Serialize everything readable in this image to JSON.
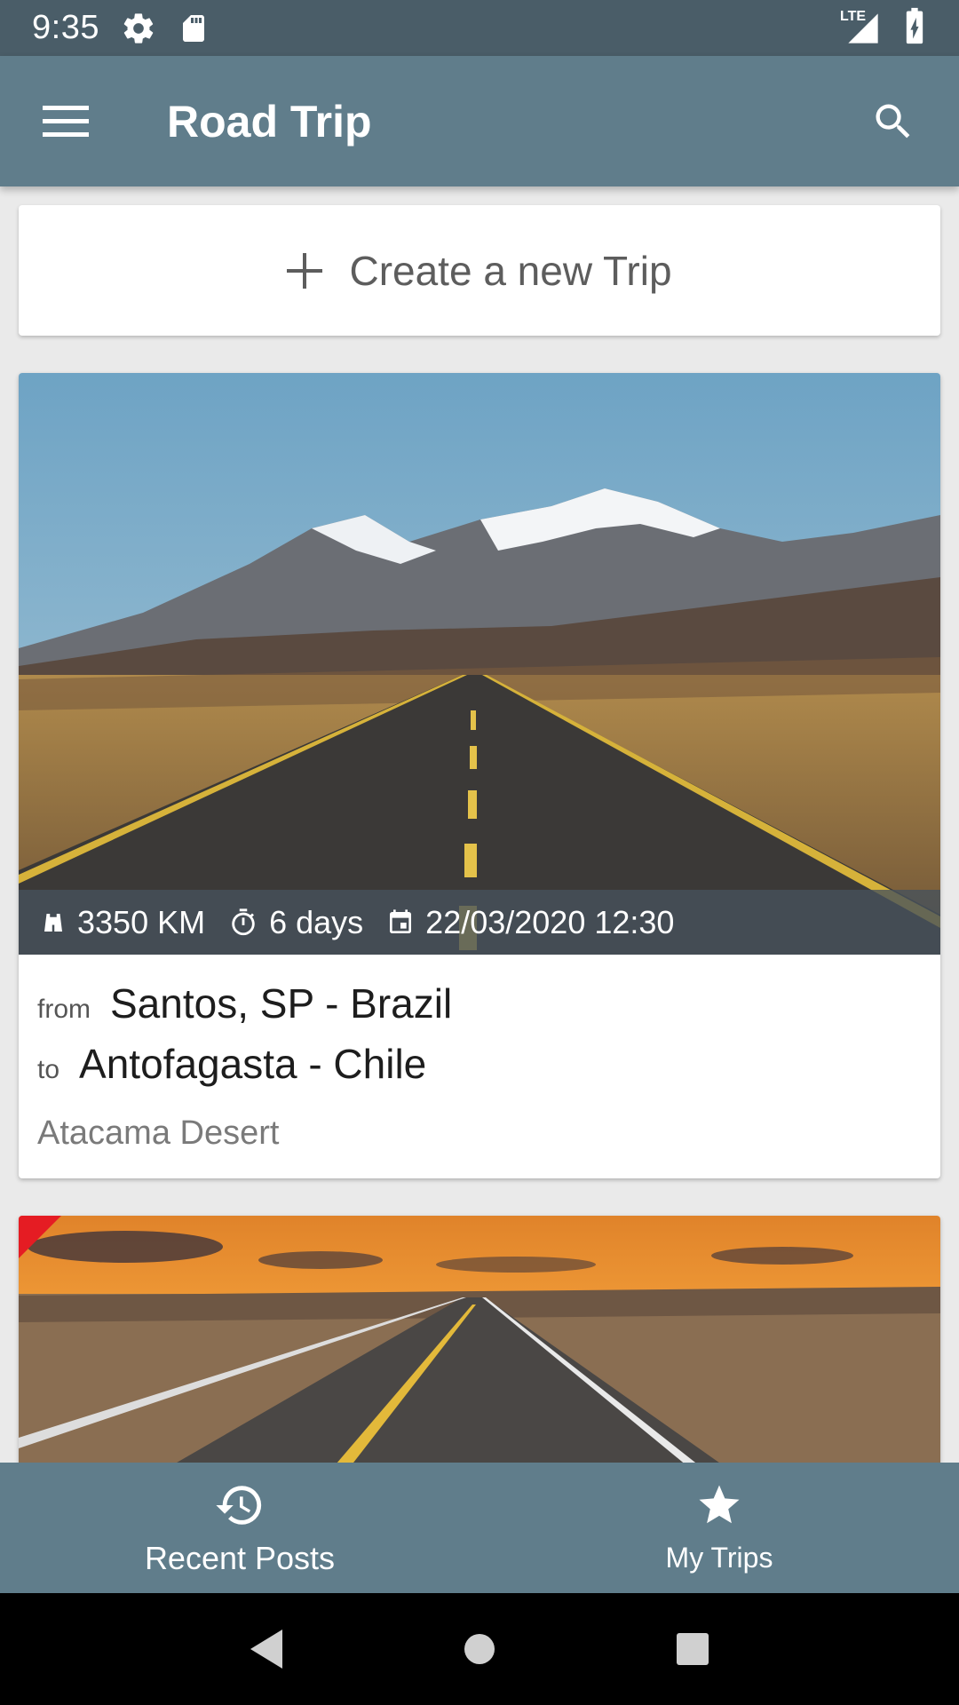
{
  "status_bar": {
    "time": "9:35",
    "network": "LTE"
  },
  "app_bar": {
    "title": "Road Trip",
    "color": "#607d8b"
  },
  "create_trip": {
    "label": "Create a new Trip"
  },
  "trips": [
    {
      "distance": "3350 KM",
      "duration": "6 days",
      "date": "22/03/2020 12:30",
      "from_label": "from",
      "from": "Santos, SP - Brazil",
      "to_label": "to",
      "to": "Antofagasta - Chile",
      "description": "Atacama Desert"
    }
  ],
  "bottom_nav": {
    "items": [
      {
        "label": "Recent Posts",
        "icon": "history-icon"
      },
      {
        "label": "My Trips",
        "icon": "star-icon"
      }
    ]
  },
  "system_nav": [
    "back",
    "home",
    "recents"
  ]
}
